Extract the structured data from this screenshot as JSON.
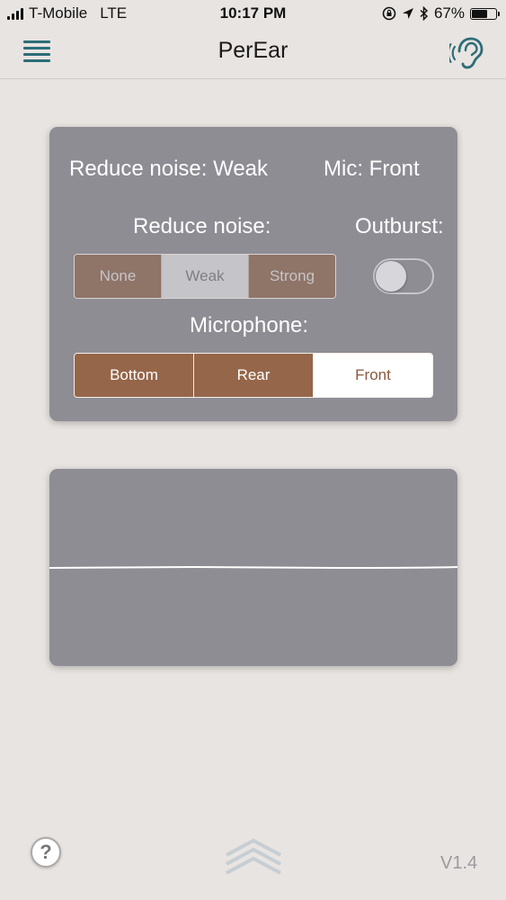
{
  "status_bar": {
    "carrier": "T-Mobile",
    "network": "LTE",
    "time": "10:17 PM",
    "battery_percent": "67%",
    "battery_level": 0.67
  },
  "nav": {
    "title": "PerEar",
    "menu_icon": "hamburger-icon",
    "right_icon": "ear-icon"
  },
  "settings": {
    "summary_noise": "Reduce noise: Weak",
    "summary_mic": "Mic: Front",
    "reduce_noise_label": "Reduce noise:",
    "outburst_label": "Outburst:",
    "outburst_on": false,
    "noise_options": [
      "None",
      "Weak",
      "Strong"
    ],
    "noise_selected": "Weak",
    "microphone_label": "Microphone:",
    "mic_options": [
      "Bottom",
      "Rear",
      "Front"
    ],
    "mic_selected": "Front"
  },
  "footer": {
    "help_label": "?",
    "version": "V1.4"
  },
  "colors": {
    "accent": "#2c6d77",
    "panel": "#8e8d94",
    "mic_segment": "#956649",
    "background": "#e8e4e1"
  }
}
